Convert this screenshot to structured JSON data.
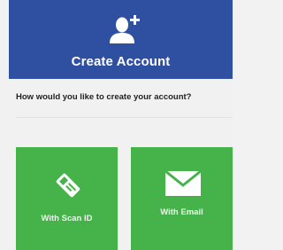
{
  "header": {
    "title": "Create Account",
    "icon": "add-user-icon",
    "background_color": "#2f4fa0"
  },
  "prompt": {
    "question": "How would you like to create your account?"
  },
  "options": [
    {
      "label": "With Scan ID",
      "icon": "id-card-icon",
      "color": "#45b34a"
    },
    {
      "label": "With Email",
      "icon": "envelope-icon",
      "color": "#45b34a"
    }
  ]
}
